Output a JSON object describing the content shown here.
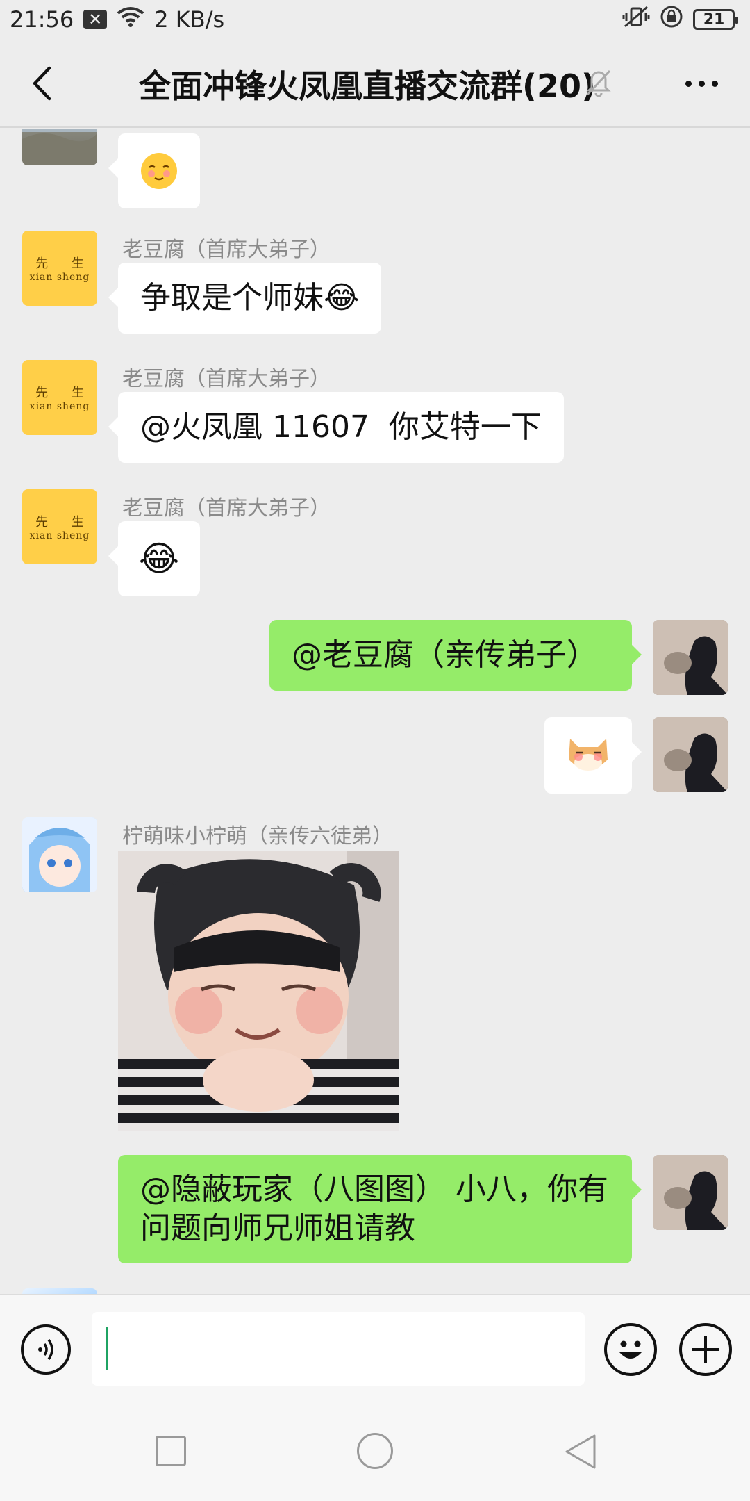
{
  "status_bar": {
    "time": "21:56",
    "notification_icon": "close-box-icon",
    "network_speed": "2 KB/s",
    "battery": "21"
  },
  "nav": {
    "title": "全面冲锋火凤凰直播交流群(20)",
    "icons": [
      "back-chevron-icon",
      "mute-bell-icon",
      "more-dots-icon"
    ]
  },
  "messages": [
    {
      "side": "in",
      "avatar": "scenery-photo",
      "type": "emoji",
      "emoji": "blush-face"
    },
    {
      "side": "in",
      "avatar": "xian-sheng",
      "sender": "老豆腐（首席大弟子）",
      "text": "争取是个师妹😂"
    },
    {
      "side": "in",
      "avatar": "xian-sheng",
      "sender": "老豆腐（首席大弟子）",
      "text": "@火凤凰 11607  你艾特一下"
    },
    {
      "side": "in",
      "avatar": "xian-sheng",
      "sender": "老豆腐（首席大弟子）",
      "type": "emoji",
      "emoji": "😂"
    },
    {
      "side": "out",
      "avatar": "self-photo",
      "text": "@老豆腐（亲传弟子）"
    },
    {
      "side": "out",
      "avatar": "self-photo",
      "type": "sticker",
      "emoji": "shiba-blush-sticker"
    },
    {
      "side": "in",
      "avatar": "anime-girl",
      "sender": "柠萌味小柠萌（亲传六徒弟）",
      "type": "image",
      "image": "baby-photo"
    },
    {
      "side": "out",
      "avatar": "self-photo",
      "text_lines": [
        "@隐蔽玩家（八图图） 小八，你有",
        "问题向师兄师姐请教"
      ]
    }
  ],
  "avatar_text": {
    "cn": "先 生",
    "py": "xian  sheng"
  },
  "input": {
    "value": "",
    "placeholder": ""
  },
  "colors": {
    "background": "#ededed",
    "bubble_in": "#ffffff",
    "bubble_out": "#95ec69",
    "cursor": "#1fa363",
    "avatar_yellow": "#ffcf48"
  }
}
